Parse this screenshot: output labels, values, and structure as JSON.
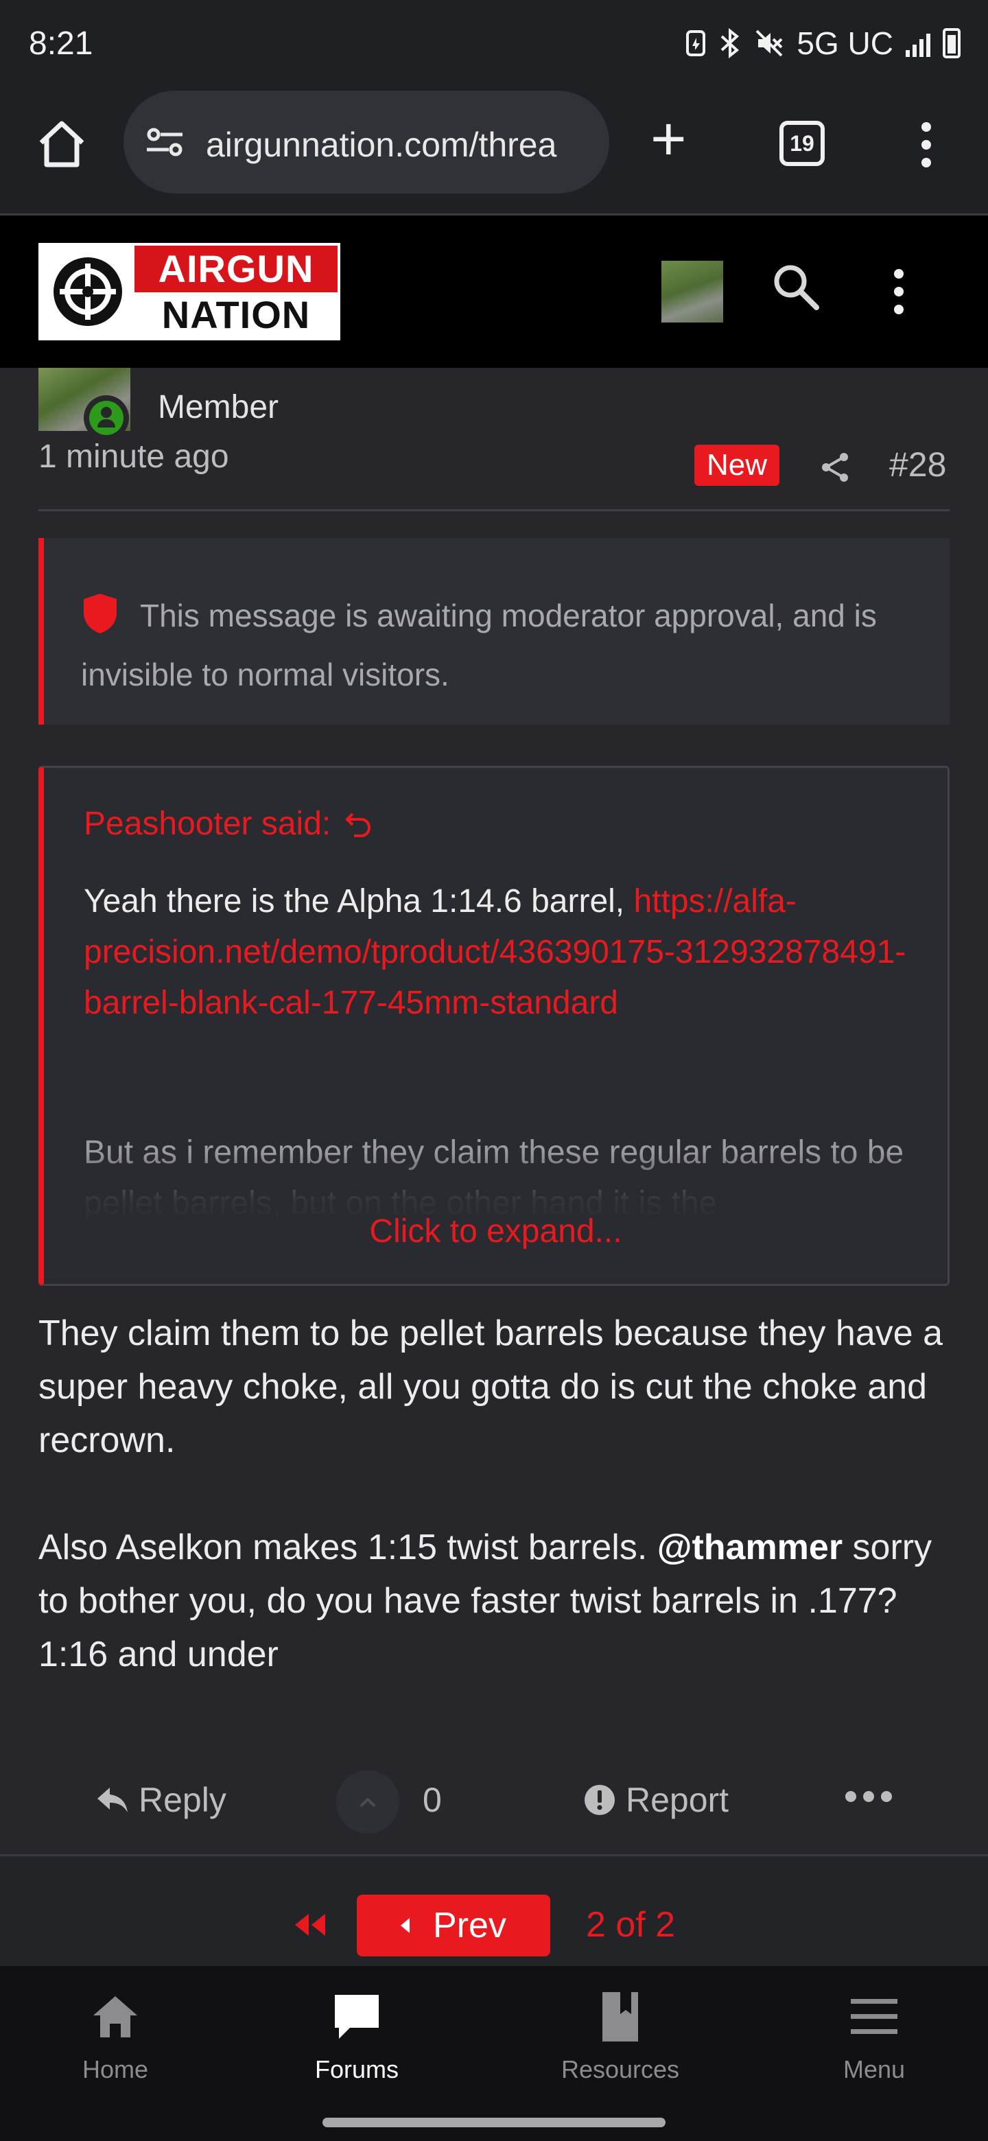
{
  "status_bar": {
    "time": "8:21",
    "network": "5G UC"
  },
  "browser": {
    "url": "airgunnation.com/threa",
    "tab_count": "19"
  },
  "site": {
    "logo_line1": "AIRGUN",
    "logo_line2": "NATION"
  },
  "post": {
    "member_title": "Member",
    "time_ago": "1 minute ago",
    "new_badge": "New",
    "post_number": "#28",
    "moderation_notice": "This message is awaiting moderator approval, and is invisible to normal visitors.",
    "quote": {
      "author_line": "Peashooter said:",
      "text_before_link": "Yeah there is the Alpha 1:14.6 barrel, ",
      "link": "https://alfa-precision.net/demo/tproduct/436390175-312932878491-barrel-blank-cal-177-45mm-standard",
      "text_continued": "But as i remember they claim these regular barrels to be pellet barrels, but on the other hand it is the",
      "expand_label": "Click to expand..."
    },
    "body_paragraph_1": "They claim them to be pellet barrels because they have a super heavy choke, all you gotta do is cut the choke and recrown.",
    "body_p2_before_mention": "Also Aselkon makes 1:15 twist barrels. ",
    "body_p2_mention": "@thammer",
    "body_p2_after_mention": " sorry to bother you, do you have faster twist barrels in .177? 1:16 and under"
  },
  "actions": {
    "reply_label": "Reply",
    "vote_count": "0",
    "report_label": "Report"
  },
  "pagination": {
    "prev_label": "Prev",
    "position": "2 of 2"
  },
  "bottom_nav": {
    "items": [
      {
        "label": "Home"
      },
      {
        "label": "Forums"
      },
      {
        "label": "Resources"
      },
      {
        "label": "Menu"
      }
    ],
    "active": "Forums"
  },
  "colors": {
    "accent": "#e8191f",
    "background": "#26262b",
    "online": "#2c9a1b"
  }
}
